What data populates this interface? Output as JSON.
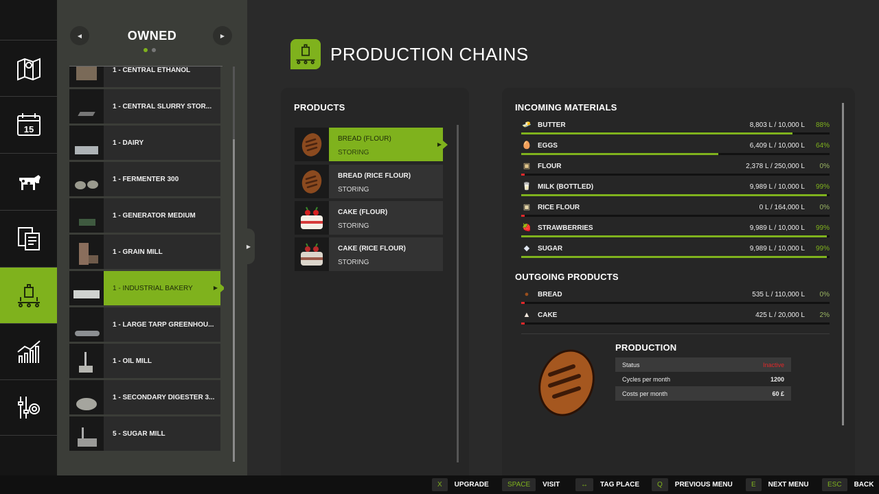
{
  "rail": {
    "items": [
      {
        "name": "map",
        "icon": "map-icon"
      },
      {
        "name": "calendar",
        "icon": "calendar-icon",
        "day": "15"
      },
      {
        "name": "animals",
        "icon": "cow-icon"
      },
      {
        "name": "contracts",
        "icon": "documents-icon"
      },
      {
        "name": "production",
        "icon": "factory-icon",
        "active": true
      },
      {
        "name": "statistics",
        "icon": "chart-icon"
      },
      {
        "name": "settings",
        "icon": "sliders-gear-icon"
      }
    ]
  },
  "owned": {
    "title": "OWNED",
    "items": [
      {
        "label": "1 - CENTRAL ETHANOL"
      },
      {
        "label": "1 - CENTRAL SLURRY STOR..."
      },
      {
        "label": "1 - DAIRY"
      },
      {
        "label": "1 - FERMENTER 300"
      },
      {
        "label": "1 - GENERATOR MEDIUM"
      },
      {
        "label": "1 - GRAIN MILL"
      },
      {
        "label": "1 - INDUSTRIAL BAKERY",
        "active": true
      },
      {
        "label": "1 - LARGE TARP GREENHOU..."
      },
      {
        "label": "1 - OIL MILL"
      },
      {
        "label": "1 - SECONDARY DIGESTER 3..."
      },
      {
        "label": "5 - SUGAR MILL"
      }
    ]
  },
  "page": {
    "title": "PRODUCTION CHAINS"
  },
  "products": {
    "title": "PRODUCTS",
    "items": [
      {
        "name": "BREAD (FLOUR)",
        "status": "STORING",
        "icon": "bread-icon",
        "active": true
      },
      {
        "name": "BREAD (RICE FLOUR)",
        "status": "STORING",
        "icon": "bread-icon"
      },
      {
        "name": "CAKE (FLOUR)",
        "status": "STORING",
        "icon": "cake-icon"
      },
      {
        "name": "CAKE (RICE FLOUR)",
        "status": "STORING",
        "icon": "cake-icon"
      }
    ]
  },
  "incoming": {
    "title": "INCOMING MATERIALS",
    "items": [
      {
        "name": "BUTTER",
        "amount": "8,803 L / 10,000 L",
        "pct": "88%",
        "fill": 0.88,
        "icon": "butter-icon"
      },
      {
        "name": "EGGS",
        "amount": "6,409 L / 10,000 L",
        "pct": "64%",
        "fill": 0.64,
        "icon": "eggs-icon"
      },
      {
        "name": "FLOUR",
        "amount": "2,378 L / 250,000 L",
        "pct": "0%",
        "fill": 0.0,
        "icon": "flour-icon"
      },
      {
        "name": "MILK (BOTTLED)",
        "amount": "9,989 L / 10,000 L",
        "pct": "99%",
        "fill": 0.99,
        "icon": "milk-icon"
      },
      {
        "name": "RICE FLOUR",
        "amount": "0 L / 164,000 L",
        "pct": "0%",
        "fill": 0.0,
        "icon": "rice-flour-icon"
      },
      {
        "name": "STRAWBERRIES",
        "amount": "9,989 L / 10,000 L",
        "pct": "99%",
        "fill": 0.99,
        "icon": "strawberry-icon"
      },
      {
        "name": "SUGAR",
        "amount": "9,989 L / 10,000 L",
        "pct": "99%",
        "fill": 0.99,
        "icon": "sugar-icon"
      }
    ]
  },
  "outgoing": {
    "title": "OUTGOING PRODUCTS",
    "items": [
      {
        "name": "BREAD",
        "amount": "535 L / 110,000 L",
        "pct": "0%",
        "fill": 0.0,
        "icon": "bread-icon"
      },
      {
        "name": "CAKE",
        "amount": "425 L / 20,000 L",
        "pct": "2%",
        "fill": 0.02,
        "icon": "cake-icon"
      }
    ]
  },
  "production": {
    "title": "PRODUCTION",
    "status_label": "Status",
    "status_value": "Inactive",
    "cycles_label": "Cycles per month",
    "cycles_value": "1200",
    "costs_label": "Costs per month",
    "costs_value": "60 £"
  },
  "bottom": {
    "hints": [
      {
        "key": "X",
        "label": "UPGRADE"
      },
      {
        "key": "SPACE",
        "label": "VISIT"
      },
      {
        "key": "↔",
        "label": "TAG PLACE"
      },
      {
        "key": "Q",
        "label": "PREVIOUS MENU"
      },
      {
        "key": "E",
        "label": "NEXT MENU"
      },
      {
        "key": "ESC",
        "label": "BACK"
      }
    ]
  },
  "colors": {
    "accent": "#7fb21d",
    "danger": "#e0282a",
    "bg": "#2a2a2a"
  }
}
